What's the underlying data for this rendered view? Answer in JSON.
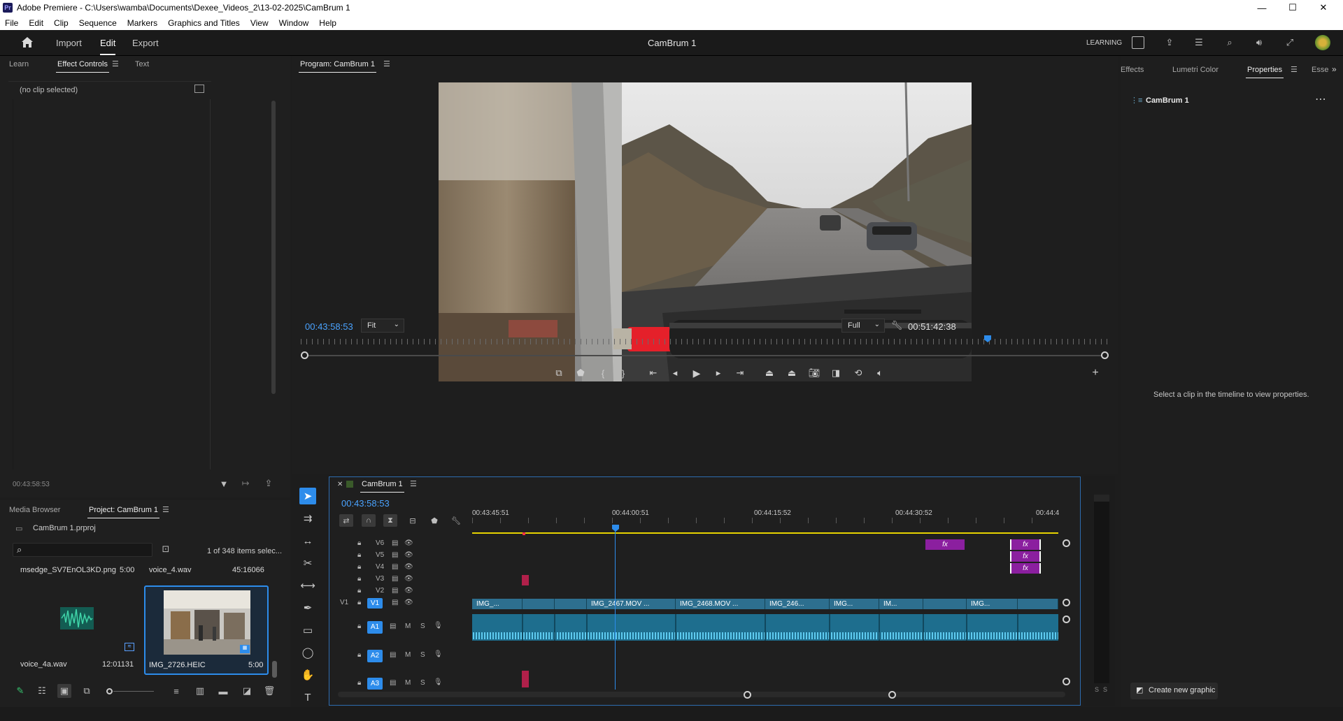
{
  "window": {
    "title": "Adobe Premiere - C:\\Users\\wamba\\Documents\\Dexee_Videos_2\\13-02-2025\\CamBrum 1",
    "app_icon": "Pr",
    "minimize": "—",
    "maximize": "☐",
    "close": "✕"
  },
  "menu": [
    "File",
    "Edit",
    "Clip",
    "Sequence",
    "Markers",
    "Graphics and Titles",
    "View",
    "Window",
    "Help"
  ],
  "topbar": {
    "nav": [
      "Import",
      "Edit",
      "Export"
    ],
    "active": "Edit",
    "project_title": "CamBrum 1",
    "learning": "LEARNING"
  },
  "left_panel": {
    "tabs": [
      "Learn",
      "Effect Controls",
      "Text"
    ],
    "active_tab": "Effect Controls",
    "no_clip": "(no clip selected)",
    "timecode": "00:43:58:53"
  },
  "program_monitor": {
    "tab": "Program: CamBrum 1",
    "timecode_current": "00:43:58:53",
    "fit": "Fit",
    "resolution": "Full",
    "timecode_duration": "00:51:42:38",
    "playhead_fraction": 0.848
  },
  "right_panel": {
    "tabs": [
      "Effects",
      "Lumetri Color",
      "Properties",
      "Esse"
    ],
    "active_tab": "Properties",
    "sequence_name": "CamBrum 1",
    "hint": "Select a clip in the timeline to view properties.",
    "create_graphic": "Create new graphic"
  },
  "project_panel": {
    "tabs": [
      "Media Browser",
      "Project: CamBrum 1"
    ],
    "active_tab": "Project: CamBrum 1",
    "project_file": "CamBrum 1.prproj",
    "search_placeholder": "",
    "items_count": "1 of 348 items selec...",
    "items": [
      {
        "name": "msedge_SV7EnOL3KD.png",
        "duration": "5:00"
      },
      {
        "name": "voice_4.wav",
        "duration": "45:16066"
      },
      {
        "name": "voice_4a.wav",
        "duration": "12:01131"
      },
      {
        "name": "IMG_2726.HEIC",
        "duration": "5:00"
      }
    ]
  },
  "timeline": {
    "sequence_tab": "CamBrum 1",
    "timecode": "00:43:58:53",
    "ruler_labels": [
      "00:43:45:51",
      "00:44:00:51",
      "00:44:15:52",
      "00:44:30:52",
      "00:44:4"
    ],
    "video_tracks": [
      "V6",
      "V5",
      "V4",
      "V3",
      "V2",
      "V1"
    ],
    "source_patch_v": "V1",
    "audio_tracks": [
      "A1",
      "A2",
      "A3"
    ],
    "audio_buttons": {
      "mute": "M",
      "solo": "S"
    },
    "v1_clips": [
      "IMG_...",
      "",
      "",
      "IMG_2467.MOV ...",
      "IMG_2468.MOV ...",
      "IMG_246...",
      "IMG...",
      "IM...",
      "",
      "IMG..."
    ],
    "fx_label": "fx",
    "meter_labels": [
      "S",
      "S"
    ]
  },
  "colors": {
    "accent_blue": "#2d8ceb",
    "timecode_blue": "#3d9bff",
    "video_clip": "#2d6f8f",
    "audio_clip": "#1e6e8e",
    "fx_clip": "#8b1f9f",
    "work_area": "#e6d300"
  }
}
